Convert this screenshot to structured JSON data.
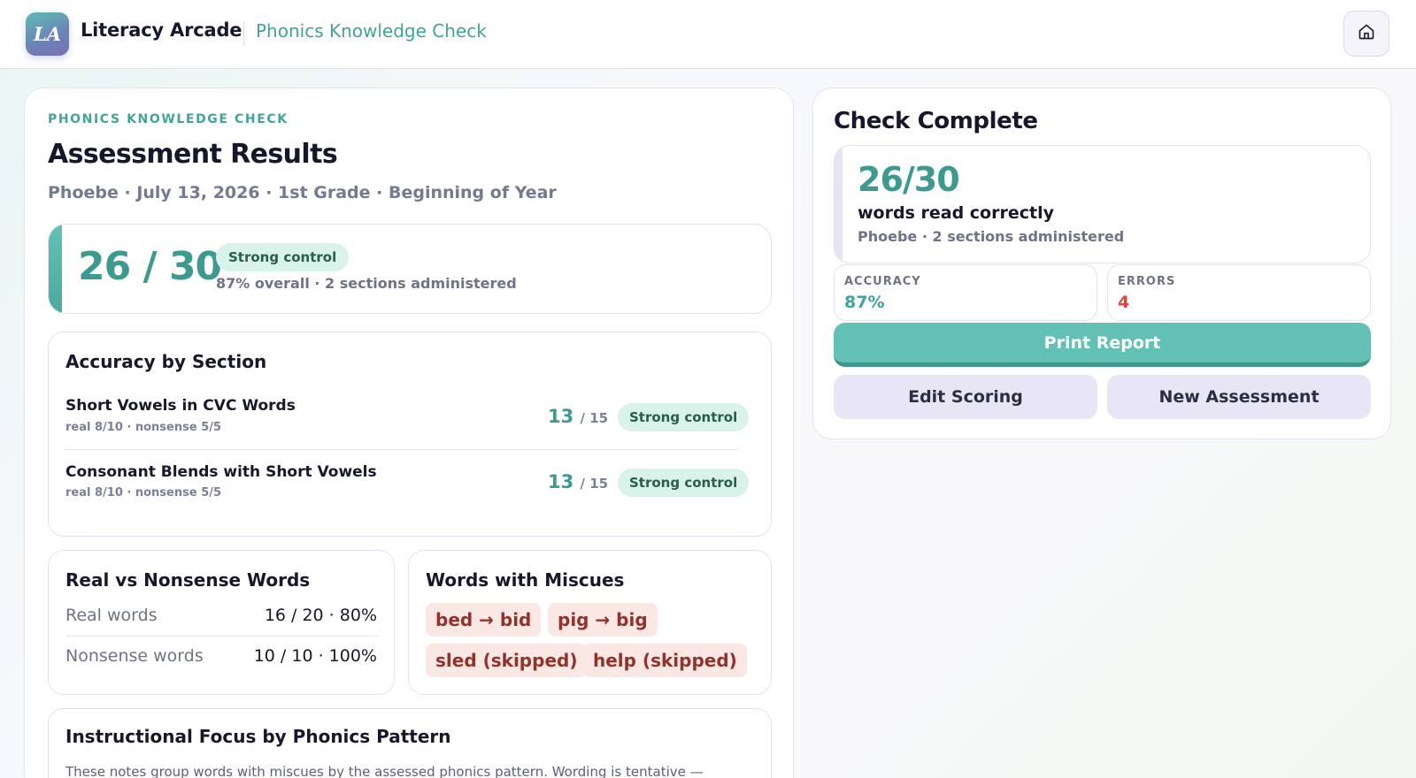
{
  "header": {
    "logo_text": "LA",
    "brand": "Literacy Arcade",
    "subtitle": "Phonics Knowledge Check",
    "home_icon": "home-icon"
  },
  "results": {
    "eyebrow": "PHONICS KNOWLEDGE CHECK",
    "title": "Assessment Results",
    "meta": "Phoebe · July 13, 2026 · 1st Grade · Beginning of Year",
    "score": "26 / 30",
    "badge": "Strong control",
    "score_note": "87% overall · 2 sections administered"
  },
  "sections": {
    "title": "Accuracy by Section",
    "rows": [
      {
        "name": "Short Vowels in CVC Words",
        "detail": "real 8/10 · nonsense 5/5",
        "correct": "13",
        "total": "/ 15",
        "badge": "Strong control"
      },
      {
        "name": "Consonant Blends with Short Vowels",
        "detail": "real 8/10 · nonsense 5/5",
        "correct": "13",
        "total": "/ 15",
        "badge": "Strong control"
      }
    ]
  },
  "real_vs_nonsense": {
    "title": "Real vs Nonsense Words",
    "rows": [
      {
        "label": "Real words",
        "value": "16 / 20 · 80%"
      },
      {
        "label": "Nonsense words",
        "value": "10 / 10 · 100%"
      }
    ]
  },
  "miscues": {
    "title": "Words with Miscues",
    "items": [
      "bed → bid",
      "pig → big",
      "sled (skipped)",
      "help (skipped)"
    ]
  },
  "focus": {
    "title": "Instructional Focus by Phonics Pattern",
    "note": "These notes group words with miscues by the assessed phonics pattern. Wording is tentative —"
  },
  "summary": {
    "title": "Check Complete",
    "score": "26/30",
    "subtitle": "words read correctly",
    "meta": "Phoebe · 2 sections administered",
    "accuracy_label": "ACCURACY",
    "accuracy_value": "87%",
    "errors_label": "ERRORS",
    "errors_value": "4",
    "print_label": "Print Report",
    "edit_label": "Edit Scoring",
    "new_label": "New Assessment"
  },
  "colors": {
    "accent": "#3fa596",
    "error": "#d9473f",
    "miscue_bg": "#fbe8e4"
  }
}
